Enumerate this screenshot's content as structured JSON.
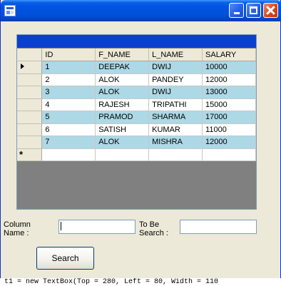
{
  "window": {
    "title": "",
    "buttons": {
      "minimize": "minimize-icon",
      "maximize": "maximize-icon",
      "close": "close-icon"
    }
  },
  "grid": {
    "columns": [
      "ID",
      "F_NAME",
      "L_NAME",
      "SALARY"
    ],
    "rows": [
      [
        "1",
        "DEEPAK",
        "DWIJ",
        "10000"
      ],
      [
        "2",
        "ALOK",
        "PANDEY",
        "12000"
      ],
      [
        "3",
        "ALOK",
        "DWIJ",
        "13000"
      ],
      [
        "4",
        "RAJESH",
        "TRIPATHI",
        "15000"
      ],
      [
        "5",
        "PRAMOD",
        "SHARMA",
        "17000"
      ],
      [
        "6",
        "SATISH",
        "KUMAR",
        "11000"
      ],
      [
        "7",
        "ALOK",
        "MISHRA",
        "12000"
      ]
    ],
    "current_row_marker": "row-pointer-icon",
    "new_row_marker": "*",
    "colors": {
      "alternate_row": "#add8e6",
      "caption_bar": "#0a3fd0",
      "empty_area": "#808080"
    }
  },
  "form": {
    "column_name_label_line1": "Column",
    "column_name_label_line2": "Name :",
    "column_name_value": "",
    "to_be_searched_label_line1": "To Be",
    "to_be_searched_label_line2": "Search :",
    "to_be_searched_value": "",
    "search_button": "Search"
  },
  "background_code_text": "t1 = new TextBox(Top = 280, Left = 80, Width = 110"
}
